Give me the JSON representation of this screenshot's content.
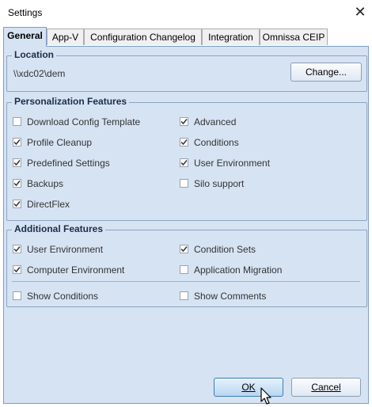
{
  "window": {
    "title": "Settings",
    "close_glyph": "✕"
  },
  "tabs": [
    {
      "label": "General",
      "active": true
    },
    {
      "label": "App-V"
    },
    {
      "label": "Configuration Changelog"
    },
    {
      "label": "Integration"
    },
    {
      "label": "Omnissa CEIP"
    }
  ],
  "location": {
    "legend": "Location",
    "path": "\\\\xdc02\\dem",
    "change_prefix": "Chan",
    "change_accel": "g",
    "change_suffix": "e..."
  },
  "personalization": {
    "legend": "Personalization Features",
    "items": [
      {
        "label": "Download Config Template",
        "checked": false
      },
      {
        "label": "Advanced",
        "checked": true
      },
      {
        "label": "Profile Cleanup",
        "checked": true
      },
      {
        "label": "Conditions",
        "checked": true
      },
      {
        "label": "Predefined Settings",
        "checked": true
      },
      {
        "label": "User Environment",
        "checked": true
      },
      {
        "label": "Backups",
        "checked": true
      },
      {
        "label": "Silo support",
        "checked": false
      },
      {
        "label": "DirectFlex",
        "checked": true
      }
    ]
  },
  "additional": {
    "legend": "Additional Features",
    "items": [
      {
        "label": "User Environment",
        "checked": true
      },
      {
        "label": "Condition Sets",
        "checked": true
      },
      {
        "label": "Computer Environment",
        "checked": true
      },
      {
        "label": "Application Migration",
        "checked": false
      },
      {
        "label": "Show Conditions",
        "checked": false
      },
      {
        "label": "Show Comments",
        "checked": false
      }
    ]
  },
  "buttons": {
    "ok": "OK",
    "cancel": "Cancel"
  },
  "colors": {
    "panel": "#d6e3f3",
    "active_tab": "#d6e3f3",
    "border": "#7a9ec6"
  }
}
